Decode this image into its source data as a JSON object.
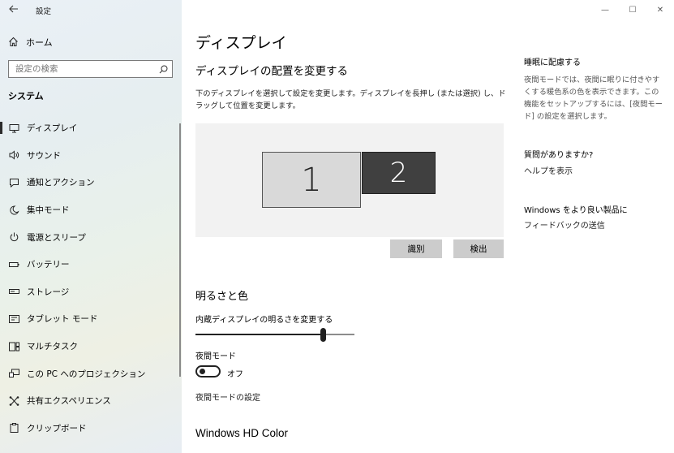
{
  "app": {
    "title": "設定",
    "back_icon": "back-arrow-icon"
  },
  "sidebar": {
    "home_label": "ホーム",
    "search_placeholder": "設定の検索",
    "section": "システム",
    "items": [
      {
        "label": "ディスプレイ",
        "icon": "monitor-icon",
        "active": true
      },
      {
        "label": "サウンド",
        "icon": "speaker-icon"
      },
      {
        "label": "通知とアクション",
        "icon": "message-icon"
      },
      {
        "label": "集中モード",
        "icon": "moon-icon"
      },
      {
        "label": "電源とスリープ",
        "icon": "power-icon"
      },
      {
        "label": "バッテリー",
        "icon": "battery-icon"
      },
      {
        "label": "ストレージ",
        "icon": "storage-icon"
      },
      {
        "label": "タブレット モード",
        "icon": "tablet-icon"
      },
      {
        "label": "マルチタスク",
        "icon": "multitask-icon"
      },
      {
        "label": "この PC へのプロジェクション",
        "icon": "projection-icon"
      },
      {
        "label": "共有エクスペリエンス",
        "icon": "shared-icon"
      },
      {
        "label": "クリップボード",
        "icon": "clipboard-icon"
      }
    ]
  },
  "window_controls": {
    "minimize": "—",
    "maximize": "☐",
    "close": "✕"
  },
  "main": {
    "title": "ディスプレイ",
    "arrange_heading": "ディスプレイの配置を変更する",
    "arrange_desc": "下のディスプレイを選択して設定を変更します。ディスプレイを長押し (または選択) し、ドラッグして位置を変更します。",
    "monitors": [
      "1",
      "2"
    ],
    "identify_label": "識別",
    "detect_label": "検出",
    "brightness_heading": "明るさと色",
    "brightness_label": "内蔵ディスプレイの明るさを変更する",
    "brightness_value": 0.8,
    "night_label": "夜間モード",
    "night_state": "オフ",
    "night_settings_link": "夜間モードの設定",
    "hdr_heading": "Windows HD Color"
  },
  "aside": {
    "sleep_title": "睡眠に配慮する",
    "sleep_desc": "夜間モードでは、夜間に眠りに付きやすくする暖色系の色を表示できます。この機能をセットアップするには、[夜間モード] の設定を選択します。",
    "question_title": "質問がありますか?",
    "help_link": "ヘルプを表示",
    "improve_title": "Windows をより良い製品に",
    "feedback_link": "フィードバックの送信"
  }
}
